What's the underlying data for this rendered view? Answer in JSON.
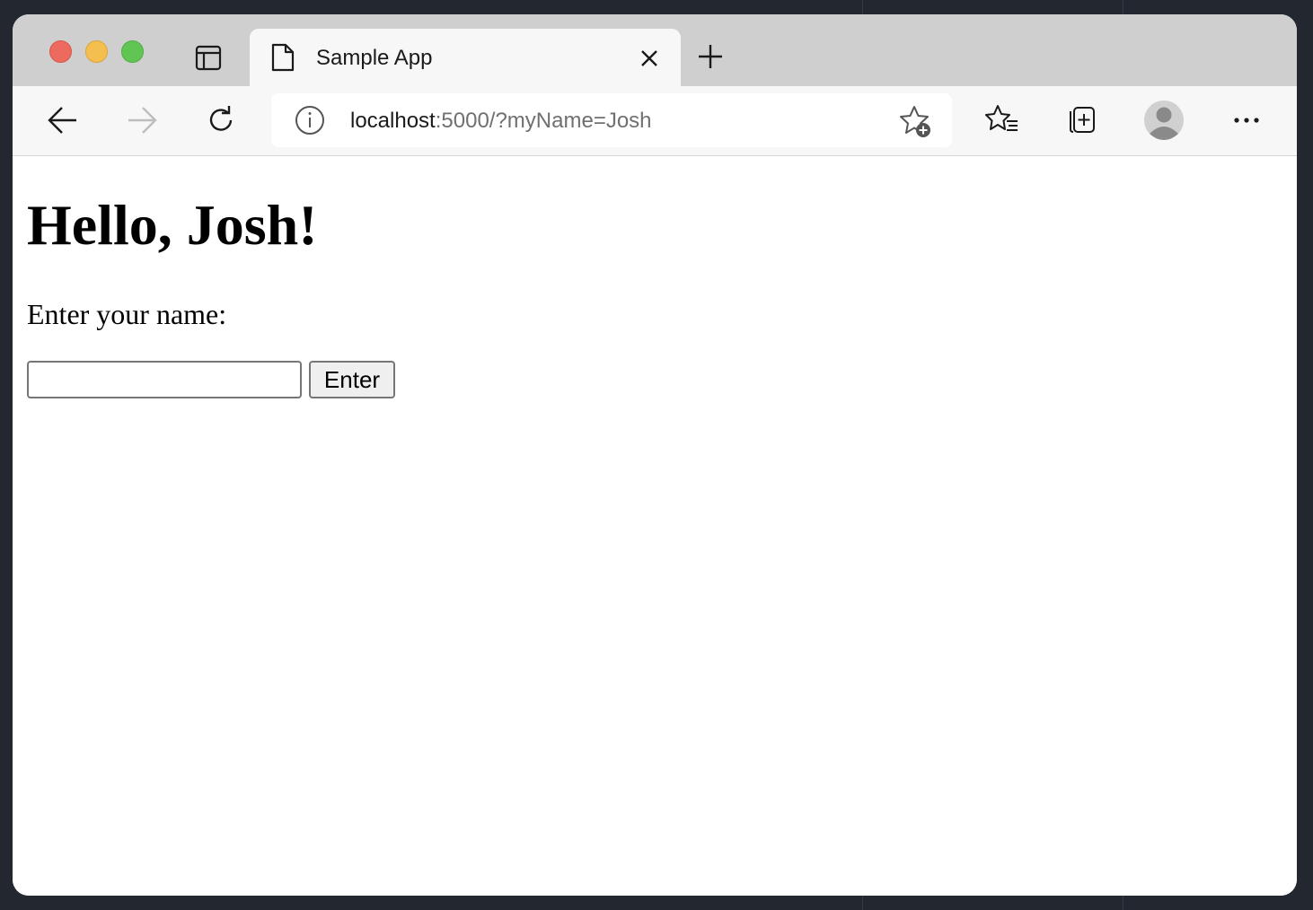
{
  "browser": {
    "tab": {
      "title": "Sample App"
    },
    "address_bar": {
      "host": "localhost",
      "rest": ":5000/?myName=Josh"
    },
    "icons": [
      "sidebar-toggle-icon",
      "page-icon",
      "close-icon",
      "new-tab-icon",
      "back-icon",
      "forward-icon",
      "reload-icon",
      "info-icon",
      "add-favorite-icon",
      "favorites-icon",
      "collections-icon",
      "profile-avatar",
      "more-icon"
    ]
  },
  "page": {
    "greeting": "Hello, Josh!",
    "prompt": "Enter your name:",
    "name_input": {
      "value": ""
    },
    "enter_button": "Enter"
  },
  "colors": {
    "tabbar": "#cfcfcf",
    "toolbar": "#f7f7f7",
    "traffic_close": "#ed6a5e",
    "traffic_minimize": "#f5bf4f",
    "traffic_maximize": "#61c554"
  }
}
